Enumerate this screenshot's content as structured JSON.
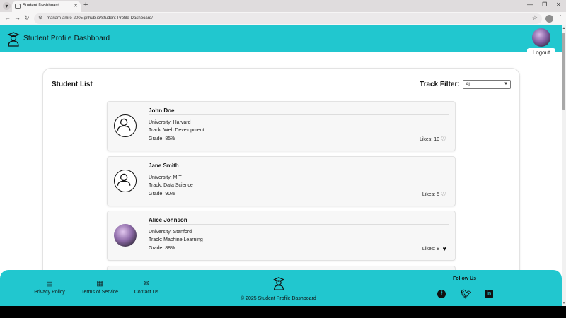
{
  "browser": {
    "tab_title": "Student Dashboard",
    "url": "mariam-amro-2005.github.io/Student-Profile-Dashboard/"
  },
  "header": {
    "brand": "Student Profile Dashboard",
    "logout_label": "Logout"
  },
  "student_list": {
    "title": "Student List",
    "filter_label": "Track Filter:",
    "filter_value": "All"
  },
  "students": [
    {
      "name": "John Doe",
      "university": "University: Harvard",
      "track": "Track: Web Development",
      "grade": "Grade: 85%",
      "likes": "Likes: 10",
      "liked": false,
      "avatar": "placeholder"
    },
    {
      "name": "Jane Smith",
      "university": "University: MIT",
      "track": "Track: Data Science",
      "grade": "Grade: 90%",
      "likes": "Likes: 5",
      "liked": false,
      "avatar": "placeholder"
    },
    {
      "name": "Alice Johnson",
      "university": "University: Stanford",
      "track": "Track: Machine Learning",
      "grade": "Grade: 88%",
      "likes": "Likes: 8",
      "liked": true,
      "avatar": "photo"
    }
  ],
  "footer": {
    "privacy": "Privacy Policy",
    "terms": "Terms of Service",
    "contact": "Contact Us",
    "copyright": "© 2025 Student Profile Dashboard",
    "follow": "Follow Us",
    "social_icons": [
      "facebook-icon",
      "twitter-icon",
      "linkedin-icon"
    ]
  },
  "colors": {
    "accent": "#21c7cf"
  }
}
